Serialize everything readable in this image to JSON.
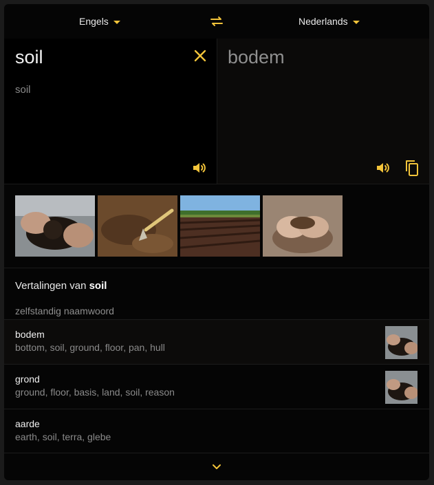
{
  "colors": {
    "accent": "#f3c43a",
    "background": "#050505",
    "target_pane": "#0b0a09"
  },
  "lang_bar": {
    "source_language": "Engels",
    "target_language": "Nederlands",
    "swap_icon": "swap-arrows-icon"
  },
  "source": {
    "text": "soil",
    "transliteration": "soil",
    "clear_icon": "close-icon",
    "speak_icon": "speaker-icon"
  },
  "target": {
    "text": "bodem",
    "speak_icon": "speaker-icon",
    "copy_icon": "copy-icon"
  },
  "images": [
    {
      "name": "hands-holding-dark-soil"
    },
    {
      "name": "trowel-in-soil"
    },
    {
      "name": "plowed-field"
    },
    {
      "name": "cupped-hands-soil"
    }
  ],
  "translations": {
    "title_prefix": "Vertalingen van ",
    "title_word": "soil",
    "part_of_speech": "zelfstandig naamwoord",
    "rows": [
      {
        "word": "bodem",
        "synonyms": "bottom, soil, ground, floor, pan, hull",
        "has_image": true
      },
      {
        "word": "grond",
        "synonyms": "ground, floor, basis, land, soil, reason",
        "has_image": true
      },
      {
        "word": "aarde",
        "synonyms": "earth, soil, terra, glebe",
        "has_image": false
      }
    ],
    "more_icon": "chevron-down-icon"
  }
}
